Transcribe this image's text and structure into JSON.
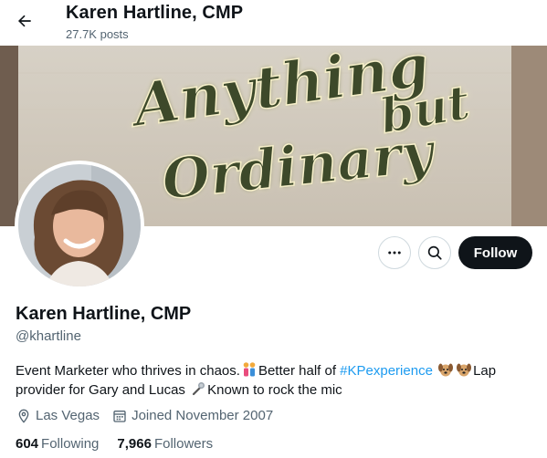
{
  "header": {
    "title": "Karen Hartline, CMP",
    "posts_count": "27.7K posts"
  },
  "banner": {
    "sign_line1": "Anything",
    "sign_line2": "but",
    "sign_line3": "Ordinary"
  },
  "actions": {
    "follow_label": "Follow"
  },
  "profile": {
    "display_name": "Karen Hartline, CMP",
    "handle": "@khartline",
    "bio": {
      "part1": "Event Marketer who thrives in chaos.",
      "part2": "Better half of ",
      "hashtag": "#KPexperience",
      "part3": "Lap",
      "part4": "provider for Gary and Lucas ",
      "part5": "Known to rock the mic"
    },
    "location": "Las Vegas",
    "joined": "Joined November 2007"
  },
  "stats": {
    "following_count": "604",
    "following_label": "Following",
    "followers_count": "7,966",
    "followers_label": "Followers"
  }
}
